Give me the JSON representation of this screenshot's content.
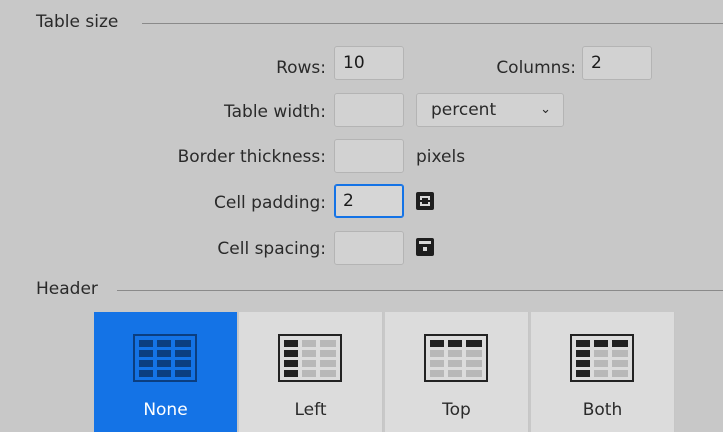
{
  "table_size": {
    "title": "Table size",
    "rows": {
      "label": "Rows:",
      "value": "10"
    },
    "columns": {
      "label": "Columns:",
      "value": "2"
    },
    "table_width": {
      "label": "Table width:",
      "value": "",
      "unit_options_selected": "percent"
    },
    "border_thickness": {
      "label": "Border thickness:",
      "value": "",
      "unit": "pixels"
    },
    "cell_padding": {
      "label": "Cell padding:",
      "value": "2"
    },
    "cell_spacing": {
      "label": "Cell spacing:",
      "value": ""
    }
  },
  "header": {
    "title": "Header",
    "options": [
      {
        "label": "None",
        "selected": true,
        "icon": "table-no-header-icon"
      },
      {
        "label": "Left",
        "selected": false,
        "icon": "table-left-header-icon"
      },
      {
        "label": "Top",
        "selected": false,
        "icon": "table-top-header-icon"
      },
      {
        "label": "Both",
        "selected": false,
        "icon": "table-both-header-icon"
      }
    ]
  },
  "colors": {
    "background": "#c8c8c8",
    "accent": "#1473e6",
    "tile": "#dcdcdc"
  }
}
